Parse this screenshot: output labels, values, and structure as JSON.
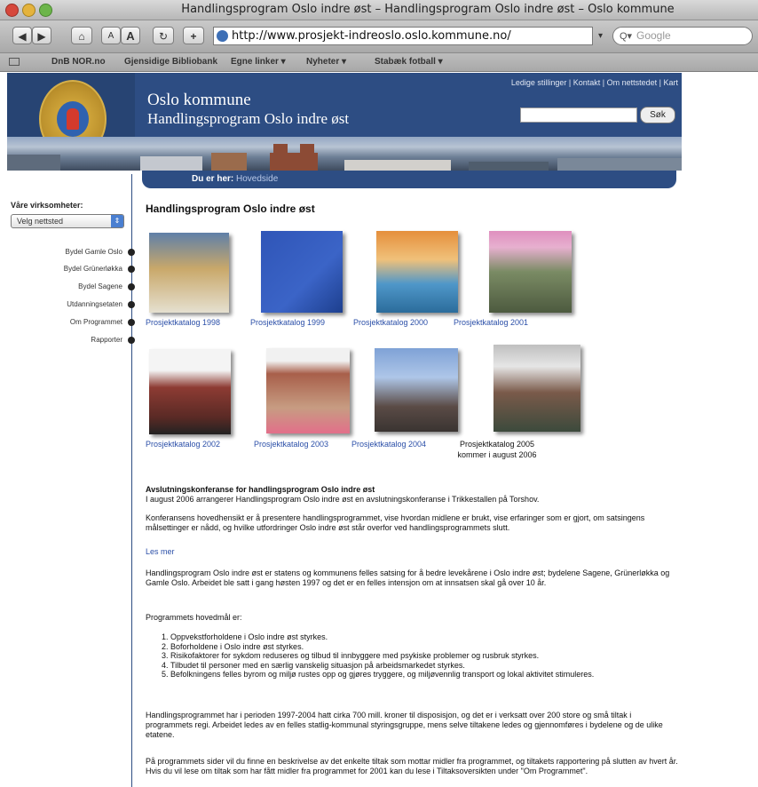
{
  "browser": {
    "window_title": "Handlingsprogram Oslo indre øst – Handlingsprogram Oslo indre øst – Oslo kommune",
    "url": "http://www.prosjekt-indreoslo.oslo.kommune.no/",
    "search_placeholder": "Google",
    "bookmarks": [
      "DnB NOR.no",
      "Gjensidige Bibliobank",
      "Egne linker ▾",
      "Nyheter ▾",
      "Stabæk fotball ▾"
    ]
  },
  "header": {
    "org_name": "Oslo kommune",
    "program_name": "Handlingsprogram Oslo indre øst",
    "top_links": "Ledige stillinger | Kontakt | Om nettstedet | Kart",
    "search_button": "Søk",
    "breadcrumb_label": "Du er her:",
    "breadcrumb_link": "Hovedside"
  },
  "sidebar": {
    "label": "Våre virksomheter:",
    "select_value": "Velg nettsted",
    "items": [
      "Bydel Gamle Oslo",
      "Bydel Grünerløkka",
      "Bydel Sagene",
      "Utdanningsetaten",
      "Om Programmet",
      "Rapporter"
    ]
  },
  "main": {
    "title": "Handlingsprogram Oslo indre øst",
    "catalogs": [
      {
        "label": "Prosjektkatalog 1998"
      },
      {
        "label": "Prosjektkatalog 1999"
      },
      {
        "label": "Prosjektkatalog 2000"
      },
      {
        "label": "Prosjektkatalog 2001"
      },
      {
        "label": "Prosjektkatalog 2002"
      },
      {
        "label": "Prosjektkatalog 2003"
      },
      {
        "label": "Prosjektkatalog 2004"
      },
      {
        "label": "Prosjektkatalog 2005",
        "note": "kommer i august 2006"
      }
    ],
    "news_title": "Avslutningskonferanse for handlingsprogram Oslo indre øst",
    "news_intro": "I august 2006 arrangerer Handlingsprogram Oslo indre øst en avslutningskonferanse i Trikkestallen på Torshov.",
    "news_body": "Konferansens hovedhensikt er å presentere handlingsprogrammet, vise hvordan midlene er brukt, vise erfaringer som er gjort, om satsingens målsettinger er nådd, og hvilke utfordringer Oslo indre øst står overfor ved handlingsprogrammets slutt.",
    "read_more": "Les mer",
    "about": "Handlingsprogram Oslo indre øst er statens og kommunens felles satsing for å bedre levekårene i Oslo indre øst; bydelene Sagene, Grünerløkka og Gamle Oslo. Arbeidet ble satt i gang høsten 1997 og det er en felles intensjon om at innsatsen skal gå over 10 år.",
    "goals_heading": "Programmets hovedmål er:",
    "goals": [
      "Oppvekstforholdene i Oslo indre øst styrkes.",
      "Boforholdene i Oslo indre øst styrkes.",
      "Risikofaktorer for sykdom reduseres og tilbud til innbyggere med psykiske problemer og rusbruk styrkes.",
      "Tilbudet til personer med en særlig vanskelig situasjon på arbeidsmarkedet styrkes.",
      "Befolkningens felles byrom og miljø rustes opp og gjøres tryggere, og miljøvennlig transport og lokal aktivitet stimuleres."
    ],
    "budget": "Handlingsprogrammet har i perioden 1997-2004 hatt cirka 700 mill. kroner til disposisjon, og det er i verksatt over 200 store og små tiltak i programmets regi. Arbeidet ledes av en felles statlig-kommunal styringsgruppe, mens selve tiltakene ledes og gjennomføres i bydelene og de ulike etatene.",
    "footer_text": "På programmets sider vil du finne en beskrivelse av det enkelte tiltak som mottar midler fra programmet, og tiltakets rapportering på slutten av hvert år. Hvis du vil lese om tiltak som har fått midler fra programmet for 2001 kan du lese i Tiltaksoversikten under \"Om Programmet\"."
  }
}
